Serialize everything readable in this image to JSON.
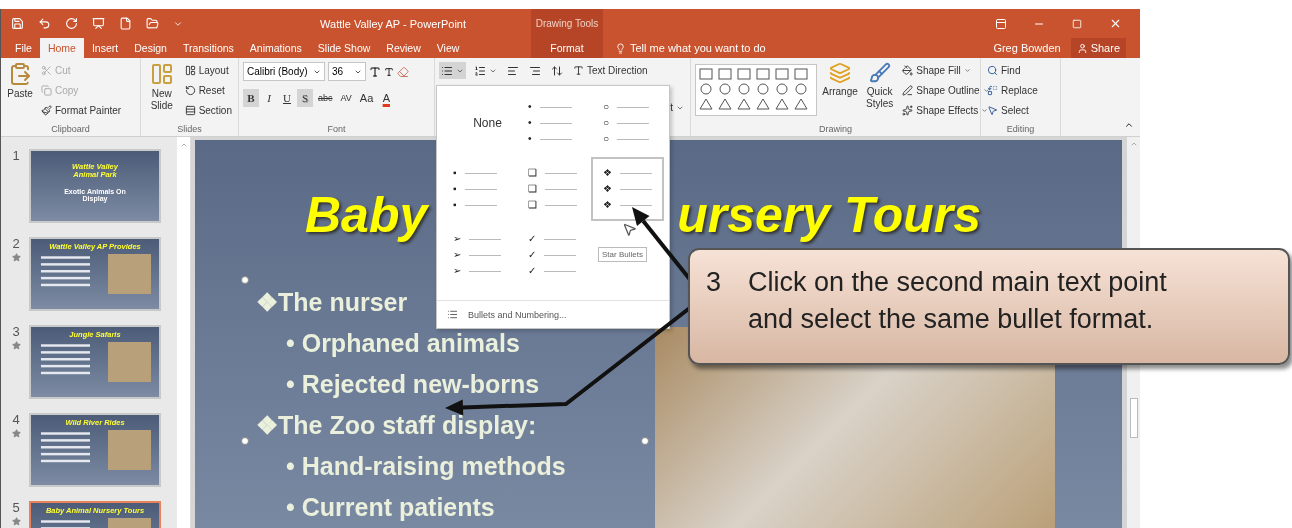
{
  "window": {
    "title": "Wattle Valley AP - PowerPoint",
    "tell_me": "Tell me what you want to do",
    "user": "Greg Bowden",
    "share": "Share"
  },
  "tabs": [
    {
      "label": "File",
      "selected": false
    },
    {
      "label": "Home",
      "selected": true
    },
    {
      "label": "Insert",
      "selected": false
    },
    {
      "label": "Design",
      "selected": false
    },
    {
      "label": "Transitions",
      "selected": false
    },
    {
      "label": "Animations",
      "selected": false
    },
    {
      "label": "Slide Show",
      "selected": false
    },
    {
      "label": "Review",
      "selected": false
    },
    {
      "label": "View",
      "selected": false
    }
  ],
  "context_tab": {
    "group": "Drawing Tools",
    "label": "Format",
    "selected": false
  },
  "ribbon": {
    "clipboard": {
      "label": "Clipboard",
      "paste": "Paste",
      "actions": [
        {
          "label": "Cut",
          "disabled": true
        },
        {
          "label": "Copy",
          "disabled": true
        },
        {
          "label": "Format Painter",
          "disabled": false
        }
      ]
    },
    "slides": {
      "label": "Slides",
      "new_slide": "New Slide",
      "actions": [
        "Layout",
        "Reset",
        "Section"
      ]
    },
    "font": {
      "label": "Font",
      "name": "Calibri (Body)",
      "size": "36",
      "styles": [
        {
          "label": "B",
          "selected": true
        },
        {
          "label": "I",
          "selected": false
        },
        {
          "label": "U",
          "selected": false
        },
        {
          "label": "S",
          "selected": true
        },
        {
          "label": "abc",
          "selected": false
        },
        {
          "label": "AV",
          "selected": false
        },
        {
          "label": "Aa",
          "selected": false
        }
      ],
      "color_label": "A"
    },
    "paragraph": {
      "bullets_selected": true,
      "text_direction": "Text Direction",
      "partial_label": "t"
    },
    "drawing": {
      "label": "Drawing",
      "arrange": "Arrange",
      "quick_styles": "Quick Styles",
      "actions": [
        "Shape Fill",
        "Shape Outline",
        "Shape Effects"
      ]
    },
    "editing": {
      "label": "Editing",
      "actions": [
        "Find",
        "Replace",
        "Select"
      ]
    }
  },
  "slides": [
    {
      "number": "1",
      "kind": "title",
      "title": "Wattle Valley Animal Park",
      "subtitle": "Exotic Animals On Display",
      "animated": false,
      "selected": false
    },
    {
      "number": "2",
      "kind": "content",
      "title": "Wattle Valley AP Provides",
      "animated": true,
      "selected": false
    },
    {
      "number": "3",
      "kind": "content",
      "title": "Jungle Safaris",
      "animated": true,
      "selected": false
    },
    {
      "number": "4",
      "kind": "content",
      "title": "Wild River Rides",
      "animated": true,
      "selected": false
    },
    {
      "number": "5",
      "kind": "content",
      "title": "Baby Animal Nursery Tours",
      "animated": true,
      "selected": true
    }
  ],
  "slide": {
    "title_start": "Baby",
    "title_end": "ursery Tours",
    "points": [
      {
        "bullet": "❖",
        "text": "The nurser",
        "children": [
          {
            "bullet": "•",
            "text": "Orphaned animals"
          },
          {
            "bullet": "•",
            "text": "Rejected new-borns"
          }
        ]
      },
      {
        "bullet": "❖",
        "text": "The Zoo staff display:",
        "children": [
          {
            "bullet": "•",
            "text": "Hand-raising methods"
          },
          {
            "bullet": "•",
            "text": "Current patients"
          }
        ]
      }
    ]
  },
  "bullet_menu": {
    "options": [
      {
        "label": "None",
        "selected": false
      },
      {
        "glyph": "•",
        "selected": false
      },
      {
        "glyph": "○",
        "selected": false
      },
      {
        "glyph": "▪",
        "selected": false
      },
      {
        "glyph": "❑",
        "selected": false
      },
      {
        "glyph": "❖",
        "selected": true
      },
      {
        "glyph": "➢",
        "selected": false
      },
      {
        "glyph": "✓",
        "selected": false
      }
    ],
    "footer": "Bullets and Numbering...",
    "tooltip": "Star Bullets"
  },
  "callout": {
    "number": "3",
    "text": "Click on the second main text point and select the same bullet format."
  }
}
